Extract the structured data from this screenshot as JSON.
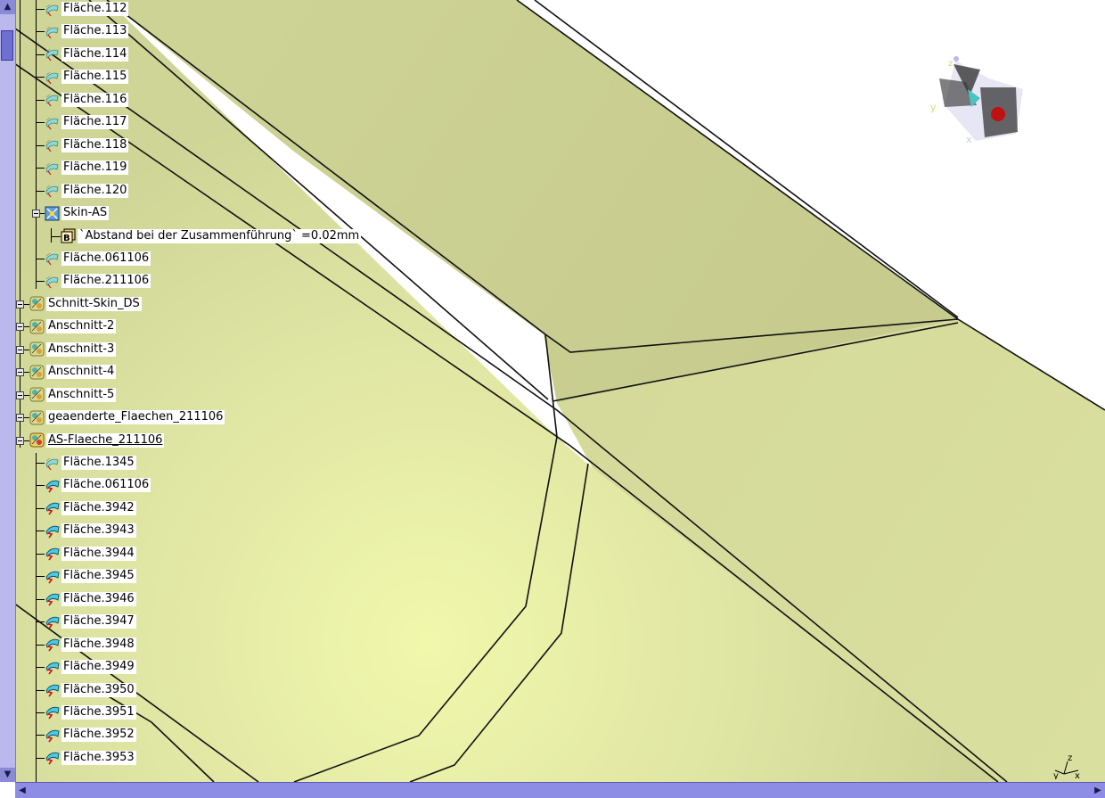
{
  "tree": {
    "nodes": [
      {
        "label": "Fläche.112",
        "level": 2,
        "icon": "surface-icon"
      },
      {
        "label": "Fläche.113",
        "level": 2,
        "icon": "surface-icon"
      },
      {
        "label": "Fläche.114",
        "level": 2,
        "icon": "surface-icon"
      },
      {
        "label": "Fläche.115",
        "level": 2,
        "icon": "surface-icon"
      },
      {
        "label": "Fläche.116",
        "level": 2,
        "icon": "surface-icon"
      },
      {
        "label": "Fläche.117",
        "level": 2,
        "icon": "surface-icon"
      },
      {
        "label": "Fläche.118",
        "level": 2,
        "icon": "surface-icon"
      },
      {
        "label": "Fläche.119",
        "level": 2,
        "icon": "surface-icon"
      },
      {
        "label": "Fläche.120",
        "level": 2,
        "icon": "surface-icon"
      },
      {
        "label": "Skin-AS",
        "level": 2,
        "icon": "join-icon",
        "expanded": true
      },
      {
        "label": "`Abstand bei der Zusammenführung` =0.02mm",
        "level": 3,
        "icon": "parameter-icon"
      },
      {
        "label": "Fläche.061106",
        "level": 2,
        "icon": "surface-icon"
      },
      {
        "label": "Fläche.211106",
        "level": 2,
        "icon": "surface-icon"
      },
      {
        "label": "Schnitt-Skin_DS",
        "level": 1,
        "icon": "geoset-icon",
        "expander": true
      },
      {
        "label": "Anschnitt-2",
        "level": 1,
        "icon": "geoset-icon",
        "expander": true
      },
      {
        "label": "Anschnitt-3",
        "level": 1,
        "icon": "geoset-icon",
        "expander": true
      },
      {
        "label": "Anschnitt-4",
        "level": 1,
        "icon": "geoset-icon",
        "expander": true
      },
      {
        "label": "Anschnitt-5",
        "level": 1,
        "icon": "geoset-icon",
        "expander": true
      },
      {
        "label": "geaenderte_Flaechen_211106",
        "level": 1,
        "icon": "geoset-icon",
        "expander": true
      },
      {
        "label": "AS-Flaeche_211106",
        "level": 1,
        "icon": "geoset-active-icon",
        "expander": true,
        "underlined": true
      },
      {
        "label": "Fläche.1345",
        "level": 2,
        "icon": "surface-icon"
      },
      {
        "label": "Fläche.061106",
        "level": 2,
        "icon": "surface-red-icon"
      },
      {
        "label": "Fläche.3942",
        "level": 2,
        "icon": "surface-red-icon"
      },
      {
        "label": "Fläche.3943",
        "level": 2,
        "icon": "surface-red-icon"
      },
      {
        "label": "Fläche.3944",
        "level": 2,
        "icon": "surface-red-icon"
      },
      {
        "label": "Fläche.3945",
        "level": 2,
        "icon": "surface-red-icon"
      },
      {
        "label": "Fläche.3946",
        "level": 2,
        "icon": "surface-red-icon"
      },
      {
        "label": "Fläche.3947",
        "level": 2,
        "icon": "surface-red-icon"
      },
      {
        "label": "Fläche.3948",
        "level": 2,
        "icon": "surface-red-icon"
      },
      {
        "label": "Fläche.3949",
        "level": 2,
        "icon": "surface-red-icon"
      },
      {
        "label": "Fläche.3950",
        "level": 2,
        "icon": "surface-red-icon"
      },
      {
        "label": "Fläche.3951",
        "level": 2,
        "icon": "surface-red-icon"
      },
      {
        "label": "Fläche.3952",
        "level": 2,
        "icon": "surface-red-icon"
      },
      {
        "label": "Fläche.3953",
        "level": 2,
        "icon": "surface-red-icon"
      }
    ]
  },
  "compass": {
    "axis_x": "x",
    "axis_y": "y",
    "axis_z": "z"
  },
  "axis_corner": {
    "x": "x",
    "y": "y",
    "z": "z"
  },
  "colors": {
    "surface_light": "#eef5a6",
    "surface_mid": "#dbe0a0",
    "surface_dark": "#c9cf92",
    "edge": "#111111",
    "scrollbar": "#8d8de6",
    "scrollbar_arrow": "#8a8ad8"
  }
}
